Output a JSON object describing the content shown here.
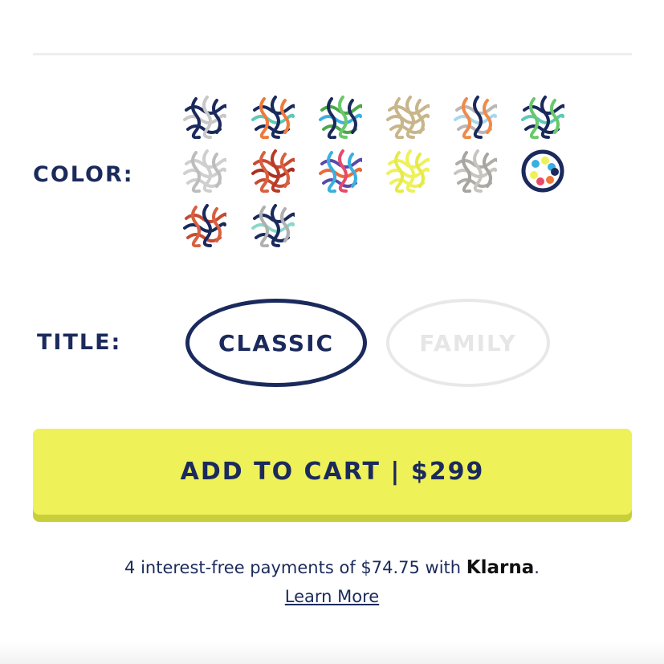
{
  "color_section": {
    "label": "COLOR:",
    "swatches": [
      {
        "name": "navy-grey",
        "colors": [
          "#1b2a5c",
          "#c8c8c8",
          "#1b2a5c",
          "#c8c8c8"
        ]
      },
      {
        "name": "teal-orange",
        "colors": [
          "#1b2a5c",
          "#5fc8b8",
          "#f07a3a",
          "#1b2a5c"
        ]
      },
      {
        "name": "green-blue",
        "colors": [
          "#4aa84a",
          "#3ab0e0",
          "#1b2a5c",
          "#6ac86a"
        ]
      },
      {
        "name": "tan",
        "colors": [
          "#c8b68a",
          "#c8b68a",
          "#c8b68a",
          "#c8b68a"
        ]
      },
      {
        "name": "orange-lightblue",
        "colors": [
          "#b8b8b8",
          "#a8d8f0",
          "#f08a4a",
          "#1b2a5c"
        ]
      },
      {
        "name": "teal-green",
        "colors": [
          "#1b2a5c",
          "#5fc8b8",
          "#6ac86a",
          "#1b2a5c"
        ]
      },
      {
        "name": "light-grey",
        "colors": [
          "#cfcfcf",
          "#cfcfcf",
          "#bdbdbd",
          "#cfcfcf"
        ]
      },
      {
        "name": "red-rust",
        "colors": [
          "#c84a30",
          "#a83020",
          "#d86040",
          "#b83a28"
        ]
      },
      {
        "name": "rainbow",
        "colors": [
          "#5a4aa8",
          "#e86a3a",
          "#3ab0e0",
          "#e84a6a"
        ]
      },
      {
        "name": "yellow",
        "colors": [
          "#eef158",
          "#eef158",
          "#e6ea48",
          "#eef158"
        ]
      },
      {
        "name": "grey-stone",
        "colors": [
          "#b0aca8",
          "#c8c4c0",
          "#a8a4a0",
          "#c8c4c0"
        ]
      },
      {
        "name": "multicolor-dots",
        "selected": true,
        "colors": [
          "#3ab0e0",
          "#eef158",
          "#f07a3a",
          "#e84a6a"
        ]
      },
      {
        "name": "red-navy",
        "colors": [
          "#c84a30",
          "#1b2a5c",
          "#d86040",
          "#1b2a5c"
        ]
      },
      {
        "name": "mint-navy",
        "colors": [
          "#1b2a5c",
          "#8ad8c8",
          "#b0b0b0",
          "#1b2a5c"
        ]
      }
    ]
  },
  "title_section": {
    "label": "TITLE:",
    "options": [
      {
        "label": "CLASSIC",
        "selected": true
      },
      {
        "label": "FAMILY",
        "selected": false,
        "disabled": true
      }
    ]
  },
  "cart": {
    "label": "ADD TO CART | $299",
    "color": "#eef158"
  },
  "klarna": {
    "text": "4 interest-free payments of $74.75 with ",
    "brand": "Klarna",
    "period": ".",
    "link": "Learn More"
  },
  "colors": {
    "navy": "#1b2a5c",
    "accent_yellow": "#eef158"
  }
}
